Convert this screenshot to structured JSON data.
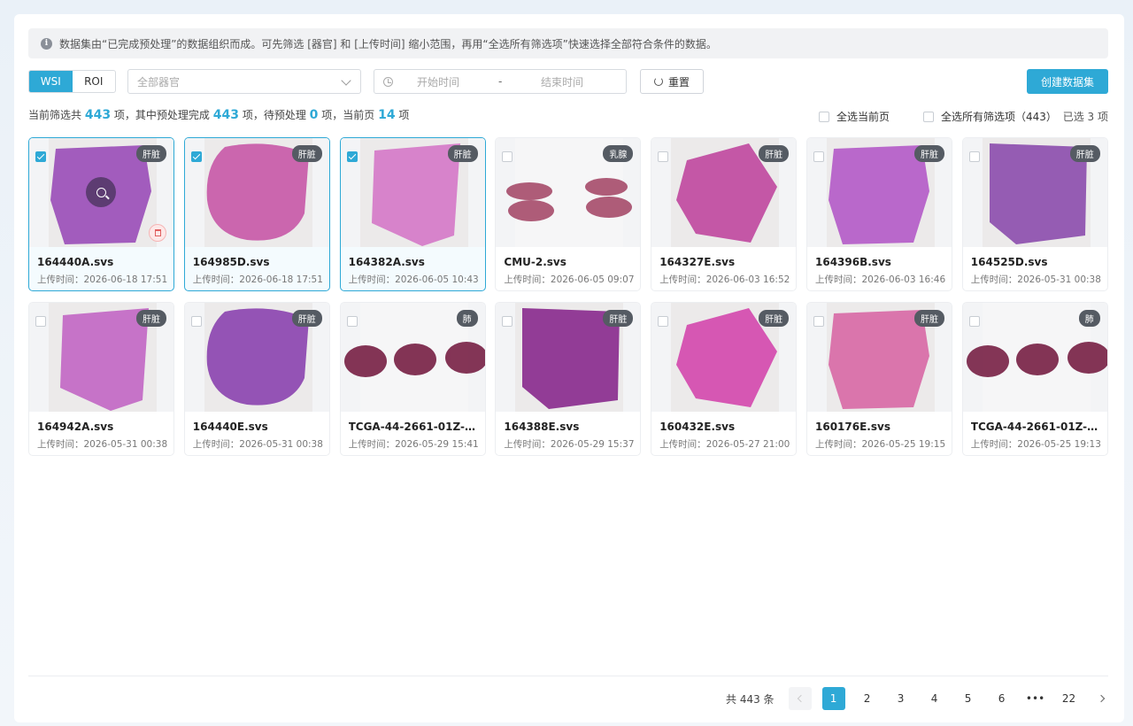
{
  "notice": "数据集由“已完成预处理”的数据组织而成。可先筛选 [器官] 和 [上传时间] 缩小范围，再用“全选所有筛选项”快速选择全部符合条件的数据。",
  "toolbar": {
    "seg_wsi": "WSI",
    "seg_roi": "ROI",
    "organ_placeholder": "全部器官",
    "start_placeholder": "开始时间",
    "range_sep": "-",
    "end_placeholder": "结束时间",
    "reset_label": "重置",
    "create_label": "创建数据集"
  },
  "stats": {
    "p1": "当前筛选共",
    "total": "443",
    "p2": "项，其中预处理完成",
    "done": "443",
    "p3": "项，待预处理",
    "pending": "0",
    "p4": "项，当前页",
    "page_count": "14",
    "p5": "项",
    "select_page": "全选当前页",
    "select_all": "全选所有筛选项（443）",
    "selected": "已选 3 项"
  },
  "time_label": "上传时间：",
  "cards": [
    {
      "name": "164440A.svs",
      "time": "2026-06-18 17:51",
      "tag": "肝脏",
      "selected": true,
      "color": "#9b4fb8",
      "shape": "blob1"
    },
    {
      "name": "164985D.svs",
      "time": "2026-06-18 17:51",
      "tag": "肝脏",
      "selected": true,
      "color": "#c85aa8",
      "shape": "blob2"
    },
    {
      "name": "164382A.svs",
      "time": "2026-06-05 10:43",
      "tag": "肝脏",
      "selected": true,
      "color": "#d57ac8",
      "shape": "blob3"
    },
    {
      "name": "CMU-2.svs",
      "time": "2026-06-05 09:07",
      "tag": "乳腺",
      "selected": false,
      "color": "#a8506e",
      "shape": "pair"
    },
    {
      "name": "164327E.svs",
      "time": "2026-06-03 16:52",
      "tag": "肝脏",
      "selected": false,
      "color": "#c04aa0",
      "shape": "blob4"
    },
    {
      "name": "164396B.svs",
      "time": "2026-06-03 16:46",
      "tag": "肝脏",
      "selected": false,
      "color": "#b45cc8",
      "shape": "blob1"
    },
    {
      "name": "164525D.svs",
      "time": "2026-05-31 00:38",
      "tag": "肝脏",
      "selected": false,
      "color": "#8d4fae",
      "shape": "blob5"
    },
    {
      "name": "164942A.svs",
      "time": "2026-05-31 00:38",
      "tag": "肝脏",
      "selected": false,
      "color": "#c268c4",
      "shape": "blob3"
    },
    {
      "name": "164440E.svs",
      "time": "2026-05-31 00:38",
      "tag": "肝脏",
      "selected": false,
      "color": "#8c45b0",
      "shape": "blob2"
    },
    {
      "name": "TCGA-44-2661-01Z-00-…",
      "time": "2026-05-29 15:41",
      "tag": "肺",
      "selected": false,
      "color": "#7a2448",
      "shape": "triple"
    },
    {
      "name": "164388E.svs",
      "time": "2026-05-29 15:37",
      "tag": "肝脏",
      "selected": false,
      "color": "#8a2c8e",
      "shape": "blob5"
    },
    {
      "name": "160432E.svs",
      "time": "2026-05-27 21:00",
      "tag": "肝脏",
      "selected": false,
      "color": "#d44aae",
      "shape": "blob4"
    },
    {
      "name": "160176E.svs",
      "time": "2026-05-25 19:15",
      "tag": "肝脏",
      "selected": false,
      "color": "#d86aa6",
      "shape": "blob1"
    },
    {
      "name": "TCGA-44-2661-01Z-00-…",
      "time": "2026-05-25 19:13",
      "tag": "肺",
      "selected": false,
      "color": "#7a2448",
      "shape": "triple"
    }
  ],
  "pagination": {
    "total": "共 443 条",
    "pages": [
      "1",
      "2",
      "3",
      "4",
      "5",
      "6",
      "•••",
      "22"
    ],
    "current": "1"
  },
  "colors": {
    "accent": "#2ea9d6"
  }
}
